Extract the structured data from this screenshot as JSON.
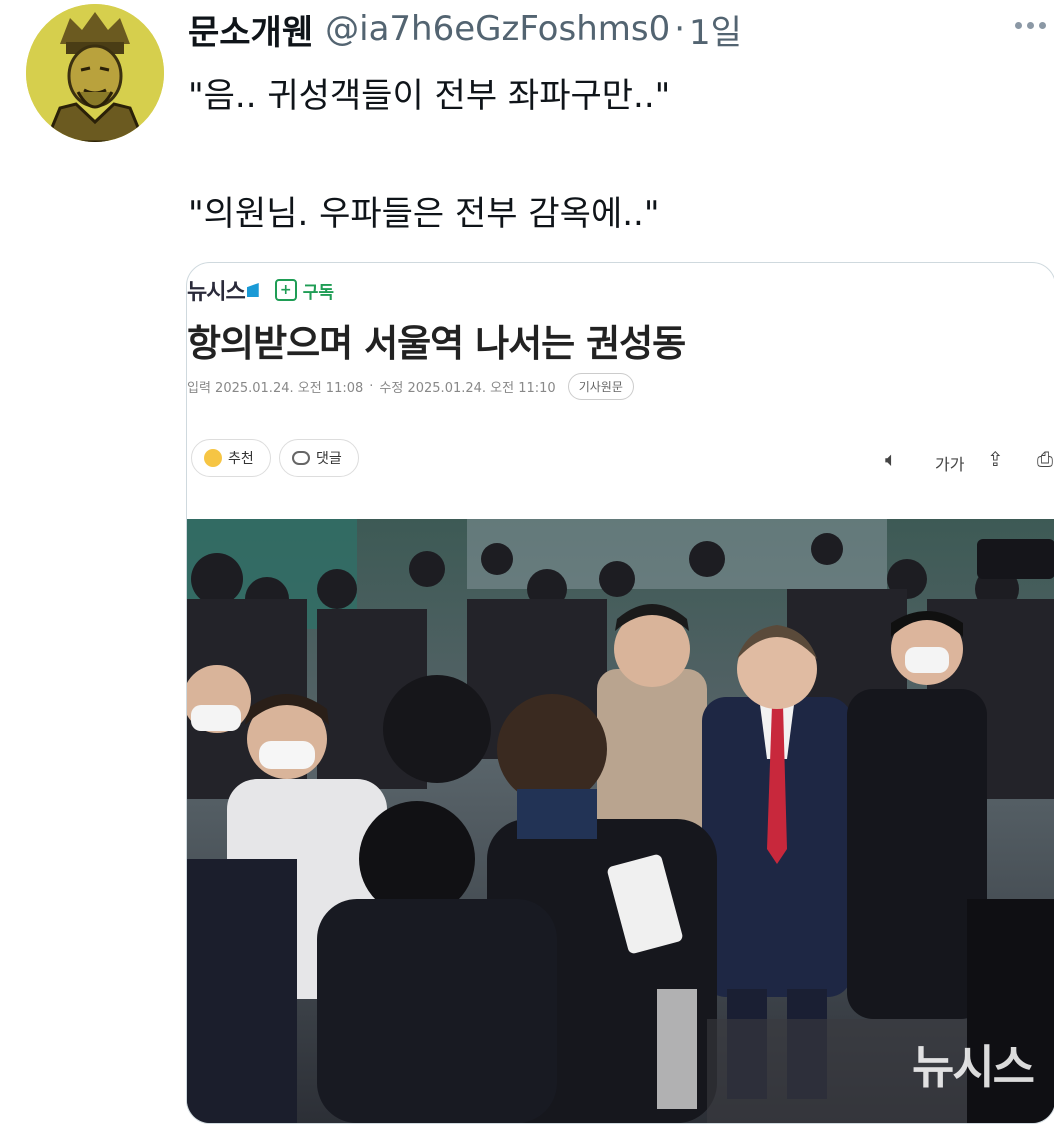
{
  "tweet": {
    "display_name": "문소개웬",
    "handle": "@ia7h6eGzFoshms0",
    "separator": "·",
    "time": "1일",
    "lines": [
      "\"음.. 귀성객들이 전부 좌파구만..\"",
      "\"의원님. 우파들은 전부 감옥에..\""
    ]
  },
  "article": {
    "brand": "뉴시스",
    "subscribe_label": "구독",
    "headline": "항의받으며 서울역 나서는 권성동",
    "published": "입력 2025.01.24. 오전 11:08",
    "separator": "·",
    "modified": "수정 2025.01.24. 오전 11:10",
    "original_label": "기사원문",
    "recommend_label": "추천",
    "comment_label": "댓글",
    "font_tool_label": "가가",
    "watermark": "뉴시스"
  },
  "icons": {
    "more": "more-icon",
    "audio": "speaker-icon",
    "share": "share-icon",
    "print": "print-icon"
  },
  "colors": {
    "subscribe_green": "#1f9d55",
    "brand_blue": "#1a9ad6",
    "avatar_bg": "#d6cf4d",
    "tie_red": "#c8283c"
  }
}
